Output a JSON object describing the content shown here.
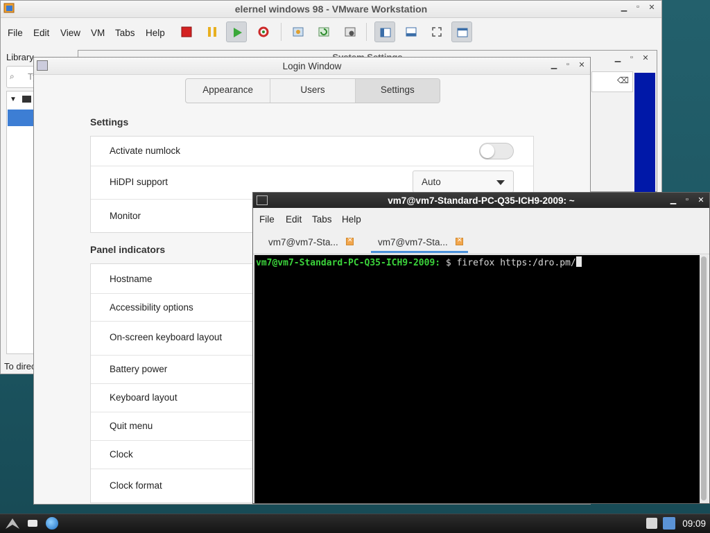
{
  "vmware": {
    "title": "elernel windows 98 - VMware Workstation",
    "menu": [
      "File",
      "Edit",
      "View",
      "VM",
      "Tabs",
      "Help"
    ],
    "library_label": "Library",
    "search_placeholder": "Ty",
    "status_text": "To direc"
  },
  "system_settings": {
    "title": "System Settings"
  },
  "login_window": {
    "title": "Login Window",
    "tabs": [
      "Appearance",
      "Users",
      "Settings"
    ],
    "active_tab": "Settings",
    "settings_heading": "Settings",
    "settings_rows": [
      {
        "label": "Activate numlock",
        "control": "toggle",
        "value": false
      },
      {
        "label": "HiDPI support",
        "control": "dropdown",
        "value": "Auto"
      },
      {
        "label": "Monitor",
        "control": "none"
      }
    ],
    "panel_heading": "Panel indicators",
    "panel_rows": [
      "Hostname",
      "Accessibility options",
      "On-screen keyboard layout",
      "Battery power",
      "Keyboard layout",
      "Quit menu",
      "Clock",
      "Clock format"
    ]
  },
  "terminal": {
    "title": "vm7@vm7-Standard-PC-Q35-ICH9-2009: ~",
    "menu": [
      "File",
      "Edit",
      "Tabs",
      "Help"
    ],
    "tabs": [
      "vm7@vm7-Sta...",
      "vm7@vm7-Sta..."
    ],
    "prompt_host": "vm7@vm7-Standard-PC-Q35-ICH9-2009:",
    "prompt_rest": " $ ",
    "command": "firefox https:/dro.pm/"
  },
  "taskbar": {
    "clock": "09:09"
  }
}
